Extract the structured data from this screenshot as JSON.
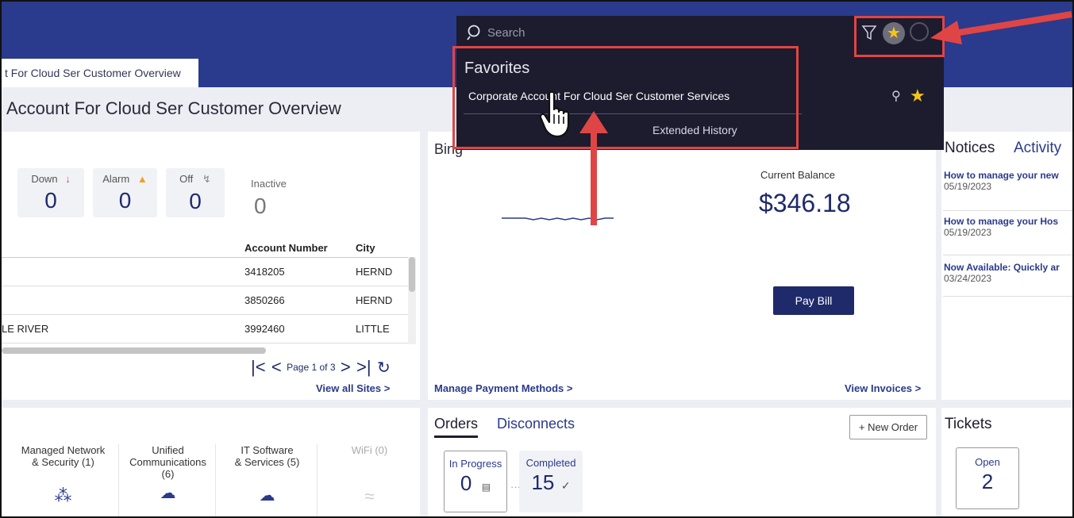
{
  "tab": {
    "label": "t For Cloud Ser Customer Overview"
  },
  "page_title": "Account For Cloud Ser Customer Overview",
  "status": {
    "down_label": "Down",
    "down_value": "0",
    "alarm_label": "Alarm",
    "alarm_value": "0",
    "off_label": "Off",
    "off_value": "0",
    "inactive_label": "Inactive",
    "inactive_value": "0"
  },
  "sites_table": {
    "headers": [
      "Account Number",
      "City"
    ],
    "rows": [
      {
        "name": "",
        "account": "3418205",
        "city": "HERND"
      },
      {
        "name": "",
        "account": "3850266",
        "city": "HERND"
      },
      {
        "name": "LE RIVER",
        "account": "3992460",
        "city": "LITTLE"
      }
    ]
  },
  "pager": {
    "text": "Page 1 of 3"
  },
  "view_all_sites": "View all Sites >",
  "billing": {
    "title": "Bi",
    "title_tail": "ng",
    "current_balance_label": "Current Balance",
    "current_balance_value": "$346.18",
    "pay_bill": "Pay Bill",
    "manage_payment": "Manage Payment Methods >",
    "view_invoices": "View Invoices >"
  },
  "notices": {
    "tab_notices": "Notices",
    "tab_activity": "Activity",
    "items": [
      {
        "title": "How to manage your new",
        "date": "05/19/2023"
      },
      {
        "title": "How to manage your Hos",
        "date": "05/19/2023"
      },
      {
        "title": "Now Available: Quickly ar",
        "date": "03/24/2023"
      }
    ]
  },
  "services": [
    {
      "label_line1": "Managed Network",
      "label_line2": "& Security (1)",
      "label_line3": ""
    },
    {
      "label_line1": "Unified",
      "label_line2": "Communications",
      "label_line3": "(6)"
    },
    {
      "label_line1": "IT Software",
      "label_line2": "& Services (5)",
      "label_line3": ""
    },
    {
      "label_line1": "WiFi (0)",
      "label_line2": "",
      "label_line3": ""
    }
  ],
  "orders": {
    "tab_orders": "Orders",
    "tab_disconnects": "Disconnects",
    "new_order": "+ New Order",
    "in_progress_label": "In Progress",
    "in_progress_value": "0",
    "completed_label": "Completed",
    "completed_value": "15"
  },
  "tickets": {
    "title": "Tickets",
    "open_label": "Open",
    "open_value": "2"
  },
  "search": {
    "placeholder": "Search"
  },
  "favorites": {
    "title": "Favorites",
    "item": "Corporate Account For Cloud Ser Customer Services",
    "extended_history": "Extended History"
  },
  "colors": {
    "brand": "#2a3a8c",
    "overlay": "#1d1b2e",
    "annotation_red": "#e04545",
    "star": "#f5c518"
  }
}
